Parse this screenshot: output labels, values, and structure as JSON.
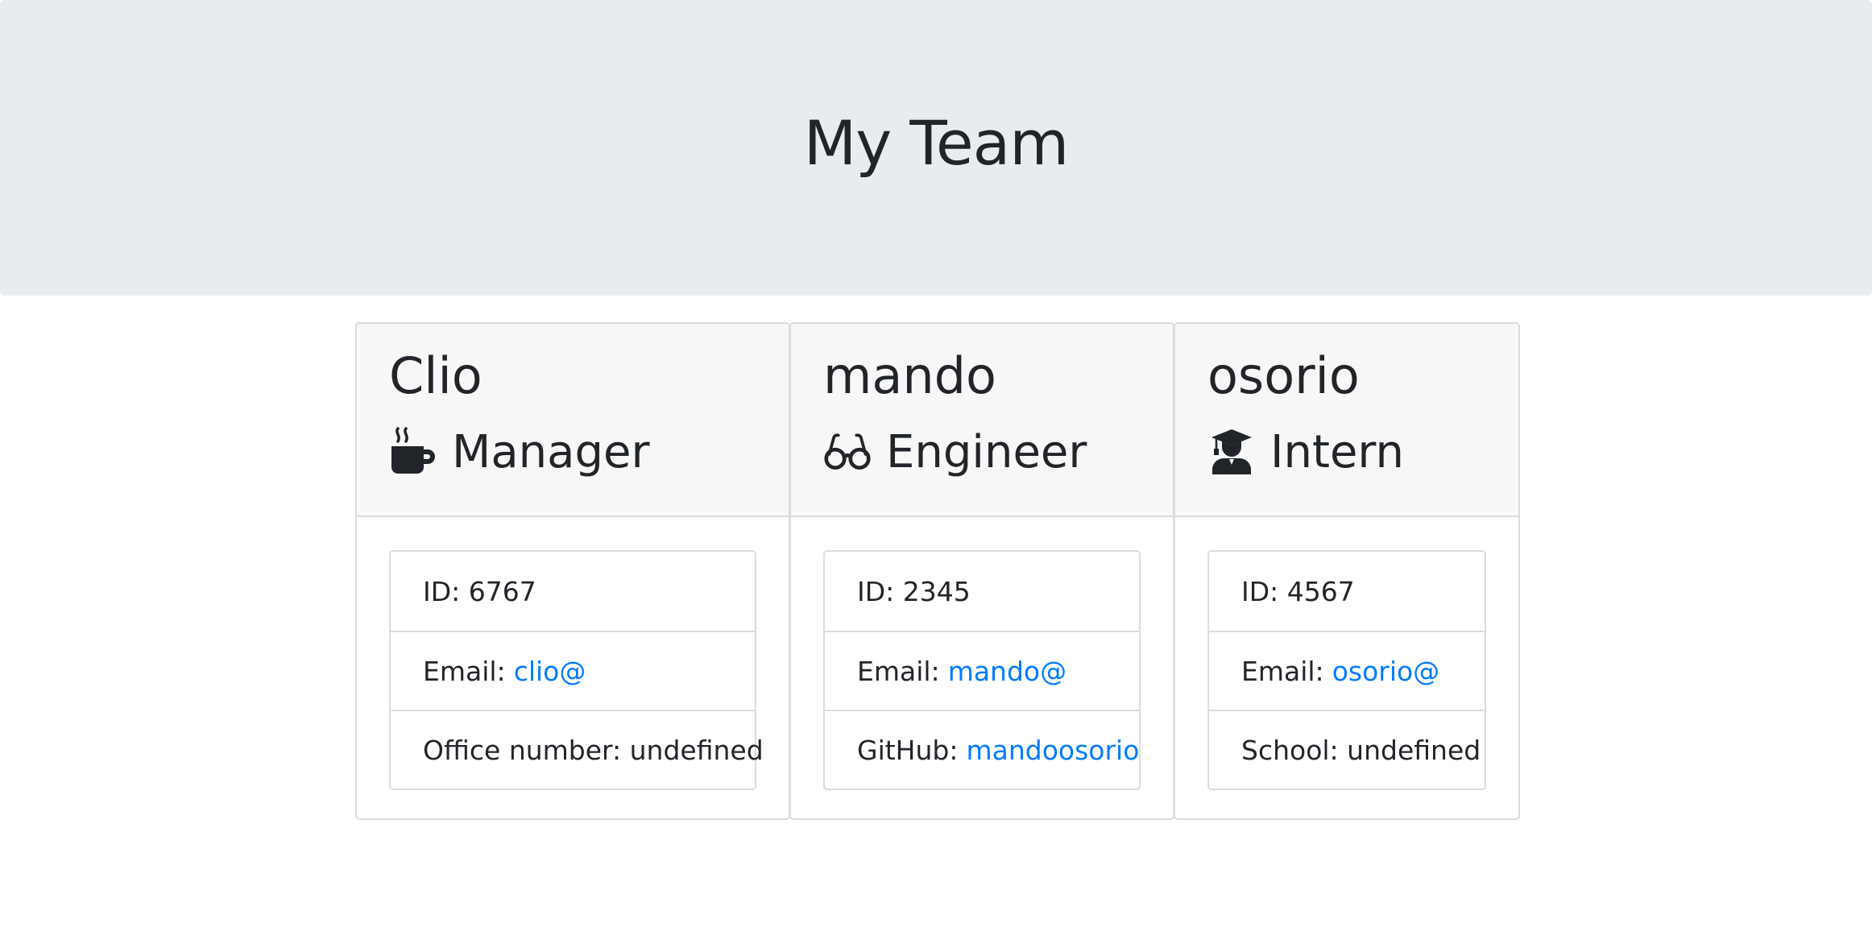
{
  "page": {
    "title": "My Team"
  },
  "team": [
    {
      "name": "Clio",
      "role": "Manager",
      "icon": "mug-icon",
      "id_label": "ID: 6767",
      "email_label": "Email:",
      "email_link": "clio@",
      "extra_label": "Office number: undefined",
      "extra_link": ""
    },
    {
      "name": "mando",
      "role": "Engineer",
      "icon": "glasses-icon",
      "id_label": "ID: 2345",
      "email_label": "Email:",
      "email_link": "mando@",
      "extra_label": "GitHub:",
      "extra_link": "mandoosorio"
    },
    {
      "name": "osorio",
      "role": "Intern",
      "icon": "graduate-icon",
      "id_label": "ID: 4567",
      "email_label": "Email:",
      "email_link": "osorio@",
      "extra_label": "School: undefined",
      "extra_link": ""
    }
  ],
  "colors": {
    "header_bg": "#e9ecef",
    "card_header_bg": "#f7f7f7",
    "link": "#007bff",
    "text": "#212529"
  }
}
